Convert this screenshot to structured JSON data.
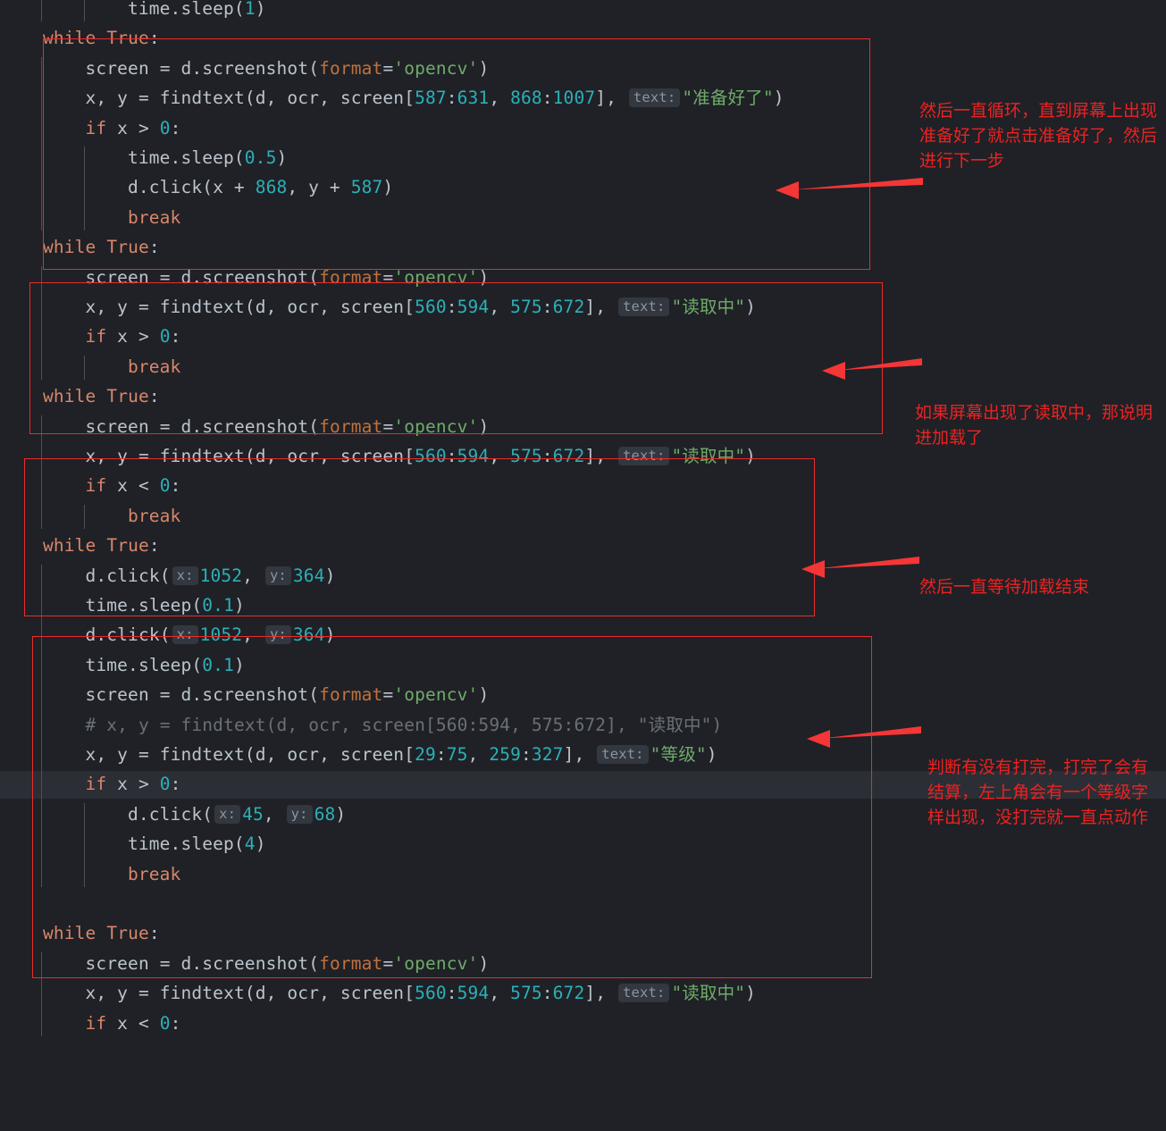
{
  "editor": {
    "theme": "dark",
    "background_color": "#1f2126",
    "current_line_highlight_color": "#2b2e35",
    "annotation_color": "#ec2222",
    "inlay_hint_bg": "#33373f"
  },
  "code_lines": [
    {
      "indent": 2,
      "tokens": [
        {
          "t": "plain",
          "s": "time.sleep("
        },
        {
          "t": "num",
          "s": "1"
        },
        {
          "t": "plain",
          "s": ")"
        }
      ]
    },
    {
      "indent": 0,
      "tokens": [
        {
          "t": "kw",
          "s": "while"
        },
        {
          "t": "plain",
          "s": " "
        },
        {
          "t": "kw",
          "s": "True"
        },
        {
          "t": "plain",
          "s": ":"
        }
      ]
    },
    {
      "indent": 1,
      "tokens": [
        {
          "t": "plain",
          "s": "screen = d.screenshot("
        },
        {
          "t": "param",
          "s": "format"
        },
        {
          "t": "plain",
          "s": "="
        },
        {
          "t": "str",
          "s": "'opencv'"
        },
        {
          "t": "plain",
          "s": ")"
        }
      ]
    },
    {
      "indent": 1,
      "tokens": [
        {
          "t": "plain",
          "s": "x, y = findtext(d, ocr, screen["
        },
        {
          "t": "num",
          "s": "587"
        },
        {
          "t": "plain",
          "s": ":"
        },
        {
          "t": "num",
          "s": "631"
        },
        {
          "t": "plain",
          "s": ", "
        },
        {
          "t": "num",
          "s": "868"
        },
        {
          "t": "plain",
          "s": ":"
        },
        {
          "t": "num",
          "s": "1007"
        },
        {
          "t": "plain",
          "s": "], "
        },
        {
          "t": "hint",
          "s": "text:"
        },
        {
          "t": "str",
          "s": "\"准备好了\""
        },
        {
          "t": "plain",
          "s": ")"
        }
      ]
    },
    {
      "indent": 1,
      "tokens": [
        {
          "t": "kw",
          "s": "if"
        },
        {
          "t": "plain",
          "s": " x > "
        },
        {
          "t": "num",
          "s": "0"
        },
        {
          "t": "plain",
          "s": ":"
        }
      ]
    },
    {
      "indent": 2,
      "tokens": [
        {
          "t": "plain",
          "s": "time.sleep("
        },
        {
          "t": "num",
          "s": "0.5"
        },
        {
          "t": "plain",
          "s": ")"
        }
      ]
    },
    {
      "indent": 2,
      "tokens": [
        {
          "t": "plain",
          "s": "d.click(x + "
        },
        {
          "t": "num",
          "s": "868"
        },
        {
          "t": "plain",
          "s": ", y + "
        },
        {
          "t": "num",
          "s": "587"
        },
        {
          "t": "plain",
          "s": ")"
        }
      ]
    },
    {
      "indent": 2,
      "tokens": [
        {
          "t": "kw",
          "s": "break"
        }
      ]
    },
    {
      "indent": 0,
      "tokens": [
        {
          "t": "kw",
          "s": "while"
        },
        {
          "t": "plain",
          "s": " "
        },
        {
          "t": "kw",
          "s": "True"
        },
        {
          "t": "plain",
          "s": ":"
        }
      ]
    },
    {
      "indent": 1,
      "tokens": [
        {
          "t": "plain",
          "s": "screen = d.screenshot("
        },
        {
          "t": "param",
          "s": "format"
        },
        {
          "t": "plain",
          "s": "="
        },
        {
          "t": "str",
          "s": "'opencv'"
        },
        {
          "t": "plain",
          "s": ")"
        }
      ]
    },
    {
      "indent": 1,
      "tokens": [
        {
          "t": "plain",
          "s": "x, y = findtext(d, ocr, screen["
        },
        {
          "t": "num",
          "s": "560"
        },
        {
          "t": "plain",
          "s": ":"
        },
        {
          "t": "num",
          "s": "594"
        },
        {
          "t": "plain",
          "s": ", "
        },
        {
          "t": "num",
          "s": "575"
        },
        {
          "t": "plain",
          "s": ":"
        },
        {
          "t": "num",
          "s": "672"
        },
        {
          "t": "plain",
          "s": "], "
        },
        {
          "t": "hint",
          "s": "text:"
        },
        {
          "t": "str",
          "s": "\"读取中\""
        },
        {
          "t": "plain",
          "s": ")"
        }
      ]
    },
    {
      "indent": 1,
      "tokens": [
        {
          "t": "kw",
          "s": "if"
        },
        {
          "t": "plain",
          "s": " x > "
        },
        {
          "t": "num",
          "s": "0"
        },
        {
          "t": "plain",
          "s": ":"
        }
      ]
    },
    {
      "indent": 2,
      "tokens": [
        {
          "t": "kw",
          "s": "break"
        }
      ]
    },
    {
      "indent": 0,
      "tokens": [
        {
          "t": "kw",
          "s": "while"
        },
        {
          "t": "plain",
          "s": " "
        },
        {
          "t": "kw",
          "s": "True"
        },
        {
          "t": "plain",
          "s": ":"
        }
      ]
    },
    {
      "indent": 1,
      "tokens": [
        {
          "t": "plain",
          "s": "screen = d.screenshot("
        },
        {
          "t": "param",
          "s": "format"
        },
        {
          "t": "plain",
          "s": "="
        },
        {
          "t": "str",
          "s": "'opencv'"
        },
        {
          "t": "plain",
          "s": ")"
        }
      ]
    },
    {
      "indent": 1,
      "tokens": [
        {
          "t": "plain",
          "s": "x, y = findtext(d, ocr, screen["
        },
        {
          "t": "num",
          "s": "560"
        },
        {
          "t": "plain",
          "s": ":"
        },
        {
          "t": "num",
          "s": "594"
        },
        {
          "t": "plain",
          "s": ", "
        },
        {
          "t": "num",
          "s": "575"
        },
        {
          "t": "plain",
          "s": ":"
        },
        {
          "t": "num",
          "s": "672"
        },
        {
          "t": "plain",
          "s": "], "
        },
        {
          "t": "hint",
          "s": "text:"
        },
        {
          "t": "str",
          "s": "\"读取中\""
        },
        {
          "t": "plain",
          "s": ")"
        }
      ]
    },
    {
      "indent": 1,
      "tokens": [
        {
          "t": "kw",
          "s": "if"
        },
        {
          "t": "plain",
          "s": " x < "
        },
        {
          "t": "num",
          "s": "0"
        },
        {
          "t": "plain",
          "s": ":"
        }
      ]
    },
    {
      "indent": 2,
      "tokens": [
        {
          "t": "kw",
          "s": "break"
        }
      ]
    },
    {
      "indent": 0,
      "tokens": [
        {
          "t": "kw",
          "s": "while"
        },
        {
          "t": "plain",
          "s": " "
        },
        {
          "t": "kw",
          "s": "True"
        },
        {
          "t": "plain",
          "s": ":"
        }
      ]
    },
    {
      "indent": 1,
      "tokens": [
        {
          "t": "plain",
          "s": "d.click("
        },
        {
          "t": "hint",
          "s": "x:"
        },
        {
          "t": "num",
          "s": "1052"
        },
        {
          "t": "plain",
          "s": ", "
        },
        {
          "t": "hint",
          "s": "y:"
        },
        {
          "t": "num",
          "s": "364"
        },
        {
          "t": "plain",
          "s": ")"
        }
      ]
    },
    {
      "indent": 1,
      "tokens": [
        {
          "t": "plain",
          "s": "time.sleep("
        },
        {
          "t": "num",
          "s": "0.1"
        },
        {
          "t": "plain",
          "s": ")"
        }
      ]
    },
    {
      "indent": 1,
      "tokens": [
        {
          "t": "plain",
          "s": "d.click("
        },
        {
          "t": "hint",
          "s": "x:"
        },
        {
          "t": "num",
          "s": "1052"
        },
        {
          "t": "plain",
          "s": ", "
        },
        {
          "t": "hint",
          "s": "y:"
        },
        {
          "t": "num",
          "s": "364"
        },
        {
          "t": "plain",
          "s": ")"
        }
      ]
    },
    {
      "indent": 1,
      "tokens": [
        {
          "t": "plain",
          "s": "time.sleep("
        },
        {
          "t": "num",
          "s": "0.1"
        },
        {
          "t": "plain",
          "s": ")"
        }
      ]
    },
    {
      "indent": 1,
      "tokens": [
        {
          "t": "plain",
          "s": "screen = d.screenshot("
        },
        {
          "t": "param",
          "s": "format"
        },
        {
          "t": "plain",
          "s": "="
        },
        {
          "t": "str",
          "s": "'opencv'"
        },
        {
          "t": "plain",
          "s": ")"
        }
      ]
    },
    {
      "indent": 1,
      "tokens": [
        {
          "t": "cmt",
          "s": "# x, y = findtext(d, ocr, screen[560:594, 575:672], \"读取中\")"
        }
      ]
    },
    {
      "indent": 1,
      "tokens": [
        {
          "t": "plain",
          "s": "x, y = findtext(d, ocr, screen["
        },
        {
          "t": "num",
          "s": "29"
        },
        {
          "t": "plain",
          "s": ":"
        },
        {
          "t": "num",
          "s": "75"
        },
        {
          "t": "plain",
          "s": ", "
        },
        {
          "t": "num",
          "s": "259"
        },
        {
          "t": "plain",
          "s": ":"
        },
        {
          "t": "num",
          "s": "327"
        },
        {
          "t": "plain",
          "s": "], "
        },
        {
          "t": "hint",
          "s": "text:"
        },
        {
          "t": "str",
          "s": "\"等级\""
        },
        {
          "t": "plain",
          "s": ")"
        }
      ]
    },
    {
      "indent": 1,
      "current": true,
      "tokens": [
        {
          "t": "kw",
          "s": "if"
        },
        {
          "t": "plain",
          "s": " x > "
        },
        {
          "t": "num",
          "s": "0"
        },
        {
          "t": "plain",
          "s": ":"
        }
      ]
    },
    {
      "indent": 2,
      "tokens": [
        {
          "t": "plain",
          "s": "d.click("
        },
        {
          "t": "hint",
          "s": "x:"
        },
        {
          "t": "num",
          "s": "45"
        },
        {
          "t": "plain",
          "s": ", "
        },
        {
          "t": "hint",
          "s": "y:"
        },
        {
          "t": "num",
          "s": "68"
        },
        {
          "t": "plain",
          "s": ")"
        }
      ]
    },
    {
      "indent": 2,
      "tokens": [
        {
          "t": "plain",
          "s": "time.sleep("
        },
        {
          "t": "num",
          "s": "4"
        },
        {
          "t": "plain",
          "s": ")"
        }
      ]
    },
    {
      "indent": 2,
      "tokens": [
        {
          "t": "kw",
          "s": "break"
        }
      ]
    },
    {
      "indent": 0,
      "tokens": []
    },
    {
      "indent": 0,
      "tokens": [
        {
          "t": "kw",
          "s": "while"
        },
        {
          "t": "plain",
          "s": " "
        },
        {
          "t": "kw",
          "s": "True"
        },
        {
          "t": "plain",
          "s": ":"
        }
      ]
    },
    {
      "indent": 1,
      "tokens": [
        {
          "t": "plain",
          "s": "screen = d.screenshot("
        },
        {
          "t": "param",
          "s": "format"
        },
        {
          "t": "plain",
          "s": "="
        },
        {
          "t": "str",
          "s": "'opencv'"
        },
        {
          "t": "plain",
          "s": ")"
        }
      ]
    },
    {
      "indent": 1,
      "tokens": [
        {
          "t": "plain",
          "s": "x, y = findtext(d, ocr, screen["
        },
        {
          "t": "num",
          "s": "560"
        },
        {
          "t": "plain",
          "s": ":"
        },
        {
          "t": "num",
          "s": "594"
        },
        {
          "t": "plain",
          "s": ", "
        },
        {
          "t": "num",
          "s": "575"
        },
        {
          "t": "plain",
          "s": ":"
        },
        {
          "t": "num",
          "s": "672"
        },
        {
          "t": "plain",
          "s": "], "
        },
        {
          "t": "hint",
          "s": "text:"
        },
        {
          "t": "str",
          "s": "\"读取中\""
        },
        {
          "t": "plain",
          "s": ")"
        }
      ]
    },
    {
      "indent": 1,
      "tokens": [
        {
          "t": "kw",
          "s": "if"
        },
        {
          "t": "plain",
          "s": " x < "
        },
        {
          "t": "num",
          "s": "0"
        },
        {
          "t": "plain",
          "s": ":"
        }
      ]
    }
  ],
  "annotations": [
    {
      "id": "note-1",
      "text": "然后一直循环，直到屏幕上出现准备好了就点击准备好了，然后进行下一步"
    },
    {
      "id": "note-2",
      "text": "如果屏幕出现了读取中，那说明进加载了"
    },
    {
      "id": "note-3",
      "text": "然后一直等待加载结束"
    },
    {
      "id": "note-4",
      "text": "判断有没有打完，打完了会有结算，左上角会有一个等级字样出现，没打完就一直点动作"
    }
  ]
}
